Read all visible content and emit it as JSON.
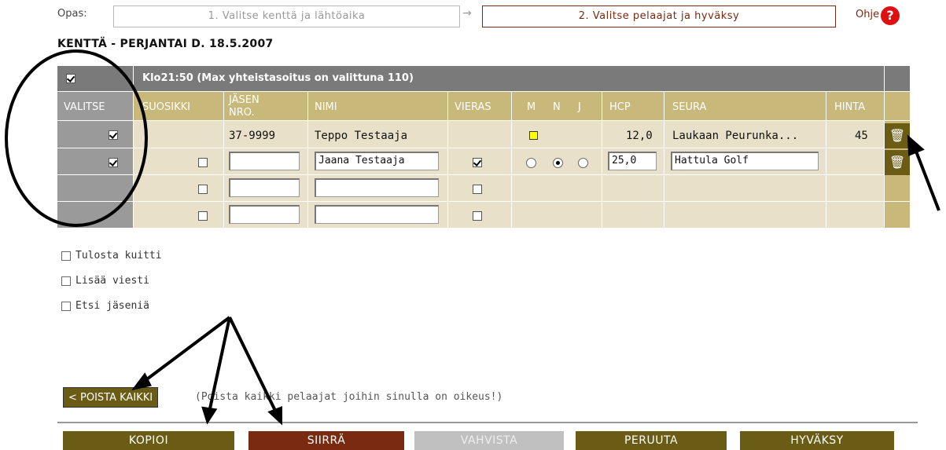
{
  "wizard": {
    "guide_label": "Opas:",
    "step1": "1. Valitse kenttä ja lähtöaika",
    "step2": "2. Valitse pelaajat ja hyväksy",
    "help_label": "Ohje",
    "help_icon": "?"
  },
  "course_title": "KENTTÄ - PERJANTAI D. 18.5.2007",
  "table": {
    "time_header": "Klo21:50 (Max yhteistasoitus on valittuna 110)",
    "columns": {
      "select": "VALITSE",
      "favorite": "SUOSIKKI",
      "member_no": [
        "JÄSEN",
        "NRO."
      ],
      "name": "NIMI",
      "guest": "VIERAS",
      "gender_m": "M",
      "gender_n": "N",
      "gender_j": "J",
      "hcp": "HCP",
      "club": "SEURA",
      "price": "HINTA"
    },
    "rows": [
      {
        "selected": true,
        "member_no": "37-9999",
        "name": "Teppo Testaaja",
        "hcp": "12,0",
        "club": "Laukaan Peurunka...",
        "price": "45"
      },
      {
        "selected": true,
        "member_no_value": "",
        "name_value": "Jaana Testaaja",
        "guest": true,
        "gender": "N",
        "hcp_value": "25,0",
        "club_value": "Hattula Golf"
      },
      {
        "selected": false,
        "member_no_value": "",
        "name_value": "",
        "guest": false
      },
      {
        "selected": false,
        "member_no_value": "",
        "name_value": "",
        "guest": false
      }
    ]
  },
  "options": {
    "print_receipt": "Tulosta kuitti",
    "add_message": "Lisää viesti",
    "search_members": "Etsi jäseniä"
  },
  "remove_all": {
    "label": "< POISTA KAIKKI",
    "note": "(Poista kaikki pelaajat joihin sinulla on oikeus!)"
  },
  "buttons": {
    "copy": "KOPIOI",
    "move": "SIIRRÄ",
    "confirm": "VAHVISTA",
    "cancel": "PERUUTA",
    "accept": "HYVÄKSY"
  },
  "colors": {
    "olive": "#6b5c15",
    "rust": "#7a2a10",
    "header_gray": "#7a7a7a",
    "tan": "#c8b87a",
    "row_bg": "#e8e0c8",
    "disabled": "#c0c0c0",
    "help_red": "#e01010"
  },
  "icons": {
    "trash": "trash-icon",
    "help": "help-icon"
  }
}
